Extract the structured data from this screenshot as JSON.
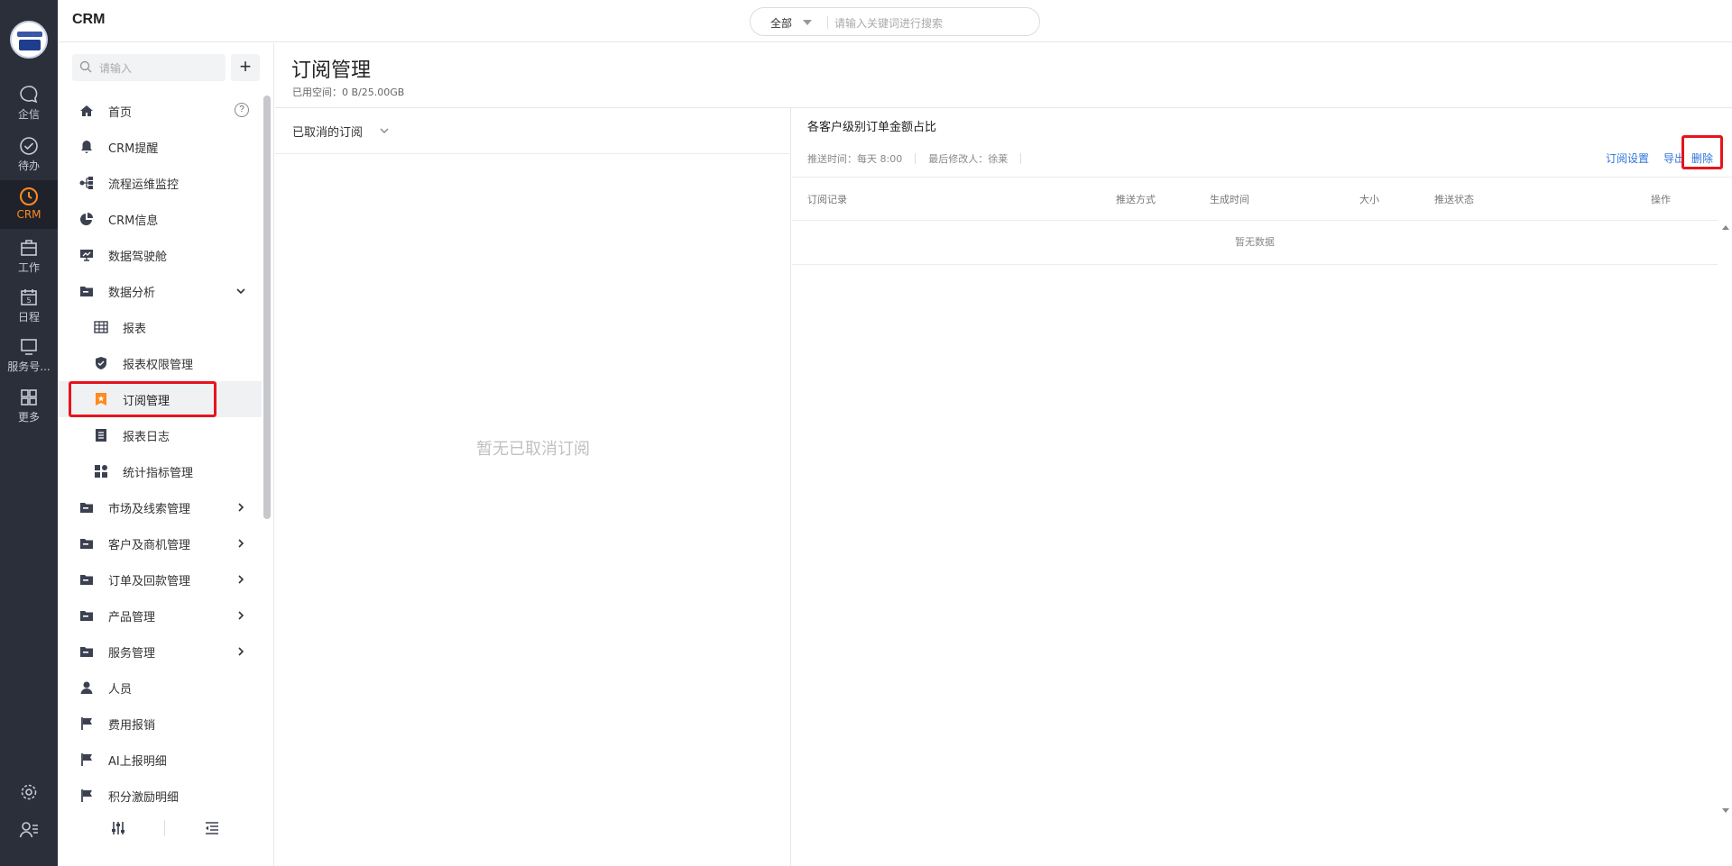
{
  "app": {
    "title": "CRM"
  },
  "search": {
    "scope": "全部",
    "placeholder": "请输入关键词进行搜索"
  },
  "rail": {
    "items": [
      {
        "label": "企信",
        "icon": "chat-bubble-icon"
      },
      {
        "label": "待办",
        "icon": "check-circle-icon"
      },
      {
        "label": "CRM",
        "icon": "clock-icon"
      },
      {
        "label": "工作",
        "icon": "briefcase-icon"
      },
      {
        "label": "日程",
        "icon": "calendar-icon"
      },
      {
        "label": "服务号...",
        "icon": "monitor-icon"
      },
      {
        "label": "更多",
        "icon": "grid-icon"
      }
    ],
    "active": "CRM"
  },
  "sidebar": {
    "search_placeholder": "请输入",
    "add_label": "+",
    "items": [
      {
        "label": "首页",
        "icon": "home-icon"
      },
      {
        "label": "CRM提醒",
        "icon": "bell-icon"
      },
      {
        "label": "流程运维监控",
        "icon": "flow-icon"
      },
      {
        "label": "CRM信息",
        "icon": "pie-icon"
      },
      {
        "label": "数据驾驶舱",
        "icon": "dashboard-icon"
      },
      {
        "label": "数据分析",
        "icon": "folder-icon"
      },
      {
        "label": "报表",
        "icon": "table-icon"
      },
      {
        "label": "报表权限管理",
        "icon": "shield-icon"
      },
      {
        "label": "订阅管理",
        "icon": "subscribe-icon"
      },
      {
        "label": "报表日志",
        "icon": "log-icon"
      },
      {
        "label": "统计指标管理",
        "icon": "metrics-icon"
      },
      {
        "label": "市场及线索管理",
        "icon": "folder-icon"
      },
      {
        "label": "客户及商机管理",
        "icon": "folder-icon"
      },
      {
        "label": "订单及回款管理",
        "icon": "folder-icon"
      },
      {
        "label": "产品管理",
        "icon": "folder-icon"
      },
      {
        "label": "服务管理",
        "icon": "folder-icon"
      },
      {
        "label": "人员",
        "icon": "person-icon"
      },
      {
        "label": "费用报销",
        "icon": "flag-icon"
      },
      {
        "label": "AI上报明细",
        "icon": "flag-icon"
      },
      {
        "label": "积分激励明细",
        "icon": "flag-icon"
      }
    ],
    "active": "订阅管理"
  },
  "main": {
    "title": "订阅管理",
    "space_used": "已用空间：0 B/25.00GB",
    "filter_label": "已取消的订阅",
    "empty_left": "暂无已取消订阅",
    "detail": {
      "title": "各客户级别订单金额占比",
      "push_time": "推送时间：每天 8:00",
      "last_modifier": "最后修改人：徐莱",
      "actions": {
        "settings": "订阅设置",
        "export": "导出",
        "delete": "删除"
      },
      "columns": [
        "订阅记录",
        "推送方式",
        "生成时间",
        "大小",
        "推送状态",
        "操作"
      ],
      "empty": "暂无数据"
    }
  },
  "colors": {
    "rail_bg": "#2b2f3a",
    "accent": "#ff8a1f",
    "link": "#2f74d8",
    "highlight": "#e8131c"
  }
}
